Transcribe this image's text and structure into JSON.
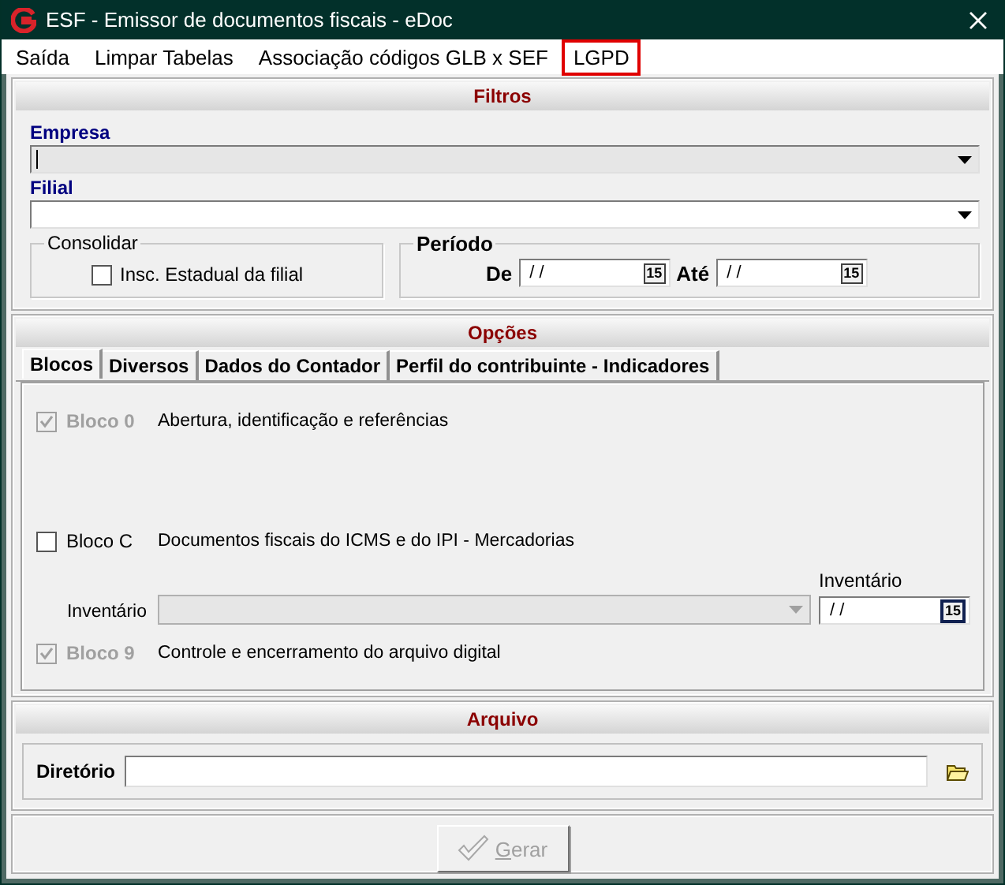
{
  "window": {
    "title": "ESF - Emissor de documentos fiscais - eDoc"
  },
  "menu": [
    {
      "label": "Saída",
      "highlighted": false
    },
    {
      "label": "Limpar Tabelas",
      "highlighted": false
    },
    {
      "label": "Associação códigos GLB x SEF",
      "highlighted": false
    },
    {
      "label": "LGPD",
      "highlighted": true
    }
  ],
  "filtros": {
    "title": "Filtros",
    "combos": [
      {
        "label": "Empresa",
        "disabled": true
      },
      {
        "label": "Filial",
        "disabled": false
      }
    ],
    "consolidar": {
      "title": "Consolidar",
      "label": "Insc. Estadual da filial",
      "checked": false
    },
    "periodo": {
      "title": "Período",
      "fields": [
        {
          "label": "De",
          "value": "/ /",
          "button": "15"
        },
        {
          "label": "Até",
          "value": "/ /",
          "button": "15"
        }
      ]
    }
  },
  "opcoes": {
    "title": "Opções",
    "tabs": [
      {
        "label": "Blocos",
        "selected": true
      },
      {
        "label": "Diversos",
        "selected": false
      },
      {
        "label": "Dados do Contador",
        "selected": false
      },
      {
        "label": "Perfil do contribuinte - Indicadores",
        "selected": false
      }
    ],
    "rows": [
      {
        "kind": "block",
        "label": "Bloco 0",
        "description": "Abertura, identificação e referências",
        "checked": true,
        "disabled": true
      },
      {
        "kind": "block",
        "label": "Bloco C",
        "description": "Documentos fiscais do ICMS e do IPI - Mercadorias",
        "checked": false,
        "disabled": false
      },
      {
        "kind": "inventory",
        "label": "Inventário",
        "disabled": true,
        "date_label": "Inventário",
        "date_value": "/ /",
        "date_button": "15"
      },
      {
        "kind": "block",
        "label": "Bloco 9",
        "description": "Controle e encerramento do arquivo digital",
        "checked": true,
        "disabled": true
      }
    ]
  },
  "arquivo": {
    "title": "Arquivo",
    "label": "Diretório"
  },
  "footer": {
    "label": "Gerar",
    "disabled": true
  }
}
